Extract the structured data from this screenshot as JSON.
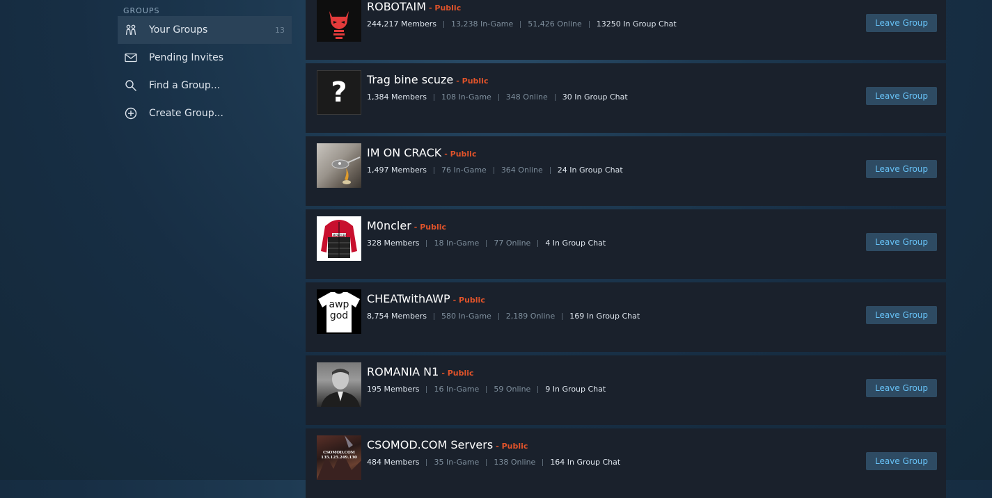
{
  "sidebar": {
    "heading": "GROUPS",
    "items": [
      {
        "label": "Your Groups",
        "count": "13",
        "icon": "users-icon",
        "active": true
      },
      {
        "label": "Pending Invites",
        "icon": "envelope-icon"
      },
      {
        "label": "Find a Group...",
        "icon": "search-icon"
      },
      {
        "label": "Create Group...",
        "icon": "plus-circle-icon"
      }
    ]
  },
  "groups": [
    {
      "name": "ROBOTAIM",
      "type": "- Public",
      "members": "244,217 Members",
      "ingame": "13,238 In-Game",
      "online": "51,426 Online",
      "chat": "13250 In Group Chat",
      "leave": "Leave Group"
    },
    {
      "name": "Trag bine scuze",
      "type": "- Public",
      "members": "1,384 Members",
      "ingame": "108 In-Game",
      "online": "348 Online",
      "chat": "30 In Group Chat",
      "leave": "Leave Group"
    },
    {
      "name": "IM ON CRACK",
      "type": "- Public",
      "members": "1,497 Members",
      "ingame": "76 In-Game",
      "online": "364 Online",
      "chat": "24 In Group Chat",
      "leave": "Leave Group"
    },
    {
      "name": "M0ncler",
      "type": "- Public",
      "members": "328 Members",
      "ingame": "18 In-Game",
      "online": "77 Online",
      "chat": "4 In Group Chat",
      "leave": "Leave Group"
    },
    {
      "name": "CHEATwithAWP",
      "type": "- Public",
      "members": "8,754 Members",
      "ingame": "580 In-Game",
      "online": "2,189 Online",
      "chat": "169 In Group Chat",
      "leave": "Leave Group"
    },
    {
      "name": "ROMANIA N1",
      "type": "- Public",
      "members": "195 Members",
      "ingame": "16 In-Game",
      "online": "59 Online",
      "chat": "9 In Group Chat",
      "leave": "Leave Group"
    },
    {
      "name": "CSOMOD.COM Servers",
      "type": "- Public",
      "members": "484 Members",
      "ingame": "35 In-Game",
      "online": "138 Online",
      "chat": "164 In Group Chat",
      "leave": "Leave Group"
    }
  ],
  "avatar_text": {
    "trag": "?",
    "awp_line1": "awp",
    "awp_line2": "god",
    "moncler": "MONCLER",
    "csomod_line1": "CSOMOD.COM",
    "csomod_line2": "135.125.249.130"
  },
  "colors": {
    "accent_public": "#e0532a",
    "button_text": "#67c1f5",
    "button_bg": "#2e4b63",
    "row_bg": "#1a212c"
  }
}
